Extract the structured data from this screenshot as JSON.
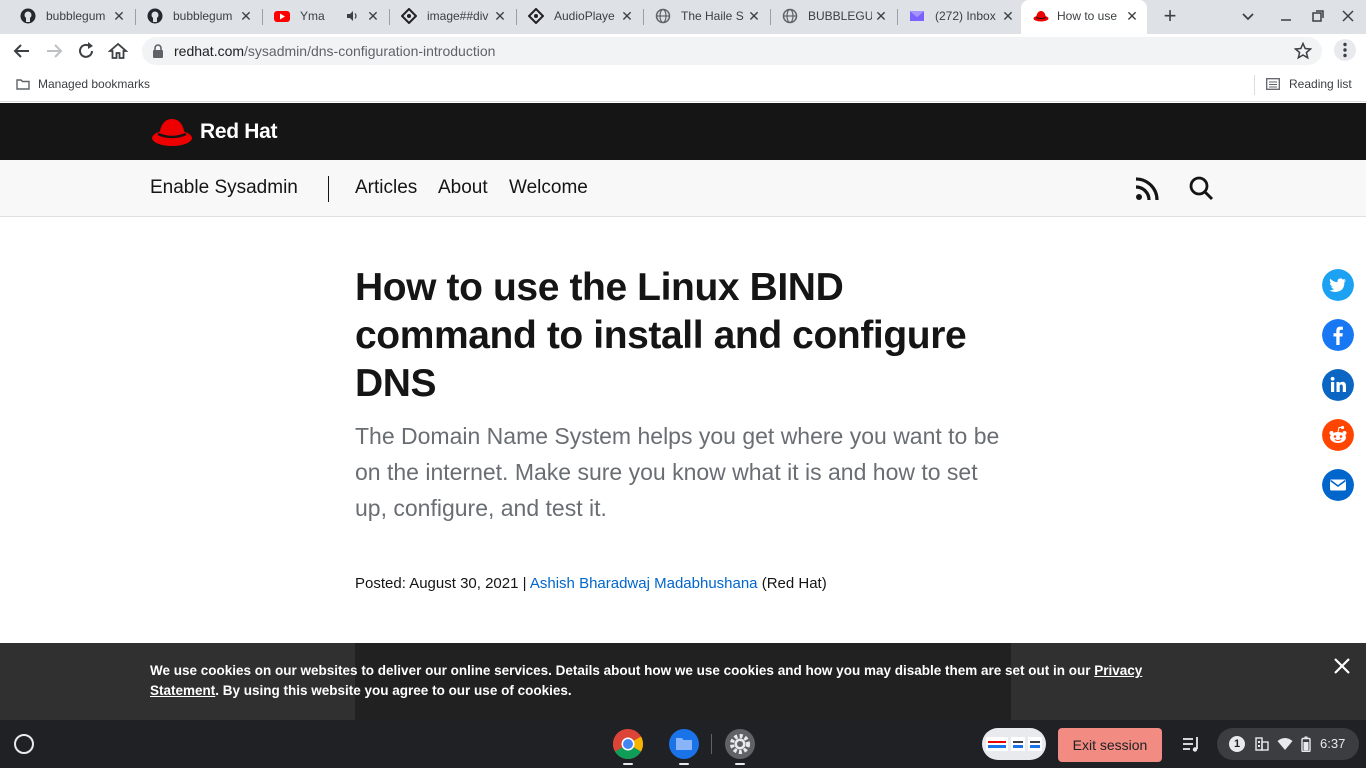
{
  "browser": {
    "tabs": [
      {
        "title": "bubblegum",
        "icon": "github-icon",
        "active": false
      },
      {
        "title": "bubblegum",
        "icon": "github-icon",
        "active": false
      },
      {
        "title": "Yma Su",
        "icon": "youtube-icon",
        "active": false,
        "audio": true
      },
      {
        "title": "image##div",
        "icon": "replit-icon",
        "active": false
      },
      {
        "title": "AudioPlaye",
        "icon": "replit-icon",
        "active": false
      },
      {
        "title": "The Haile S",
        "icon": "globe-icon",
        "active": false
      },
      {
        "title": "BUBBLEGUI",
        "icon": "globe-icon",
        "active": false
      },
      {
        "title": "(272) Inbox",
        "icon": "mail-icon",
        "active": false
      },
      {
        "title": "How to use",
        "icon": "redhat-icon",
        "active": true
      }
    ],
    "url_host": "redhat.com",
    "url_path": "/sysadmin/dns-configuration-introduction",
    "bookmarks_label": "Managed bookmarks",
    "reading_list_label": "Reading list"
  },
  "site": {
    "brand": "Red Hat",
    "subnav": {
      "brand": "Enable Sysadmin",
      "links": [
        "Articles",
        "About",
        "Welcome"
      ]
    }
  },
  "article": {
    "title": "How to use the Linux BIND command to install and configure DNS",
    "subtitle": "The Domain Name System helps you get where you want to be on the internet. Make sure you know what it is and how to set up, configure, and test it.",
    "posted_label": "Posted: August 30, 2021 |",
    "author": "Ashish Bharadwaj Madabhushana",
    "affiliation": "(Red Hat)"
  },
  "share": [
    "twitter-icon",
    "facebook-icon",
    "linkedin-icon",
    "reddit-icon",
    "email-icon"
  ],
  "cookie": {
    "text_before": "We use cookies on our websites to deliver our online services. Details about how we use cookies and how you may disable them are set out in our ",
    "link": "Privacy Statement",
    "text_after": ". By using this website you agree to our use of cookies."
  },
  "shelf": {
    "exit_label": "Exit session",
    "notification_count": "1",
    "time": "6:37"
  },
  "colors": {
    "accent_red": "#ee0000",
    "link_blue": "#0066cc",
    "exit_button": "#f28b82"
  }
}
